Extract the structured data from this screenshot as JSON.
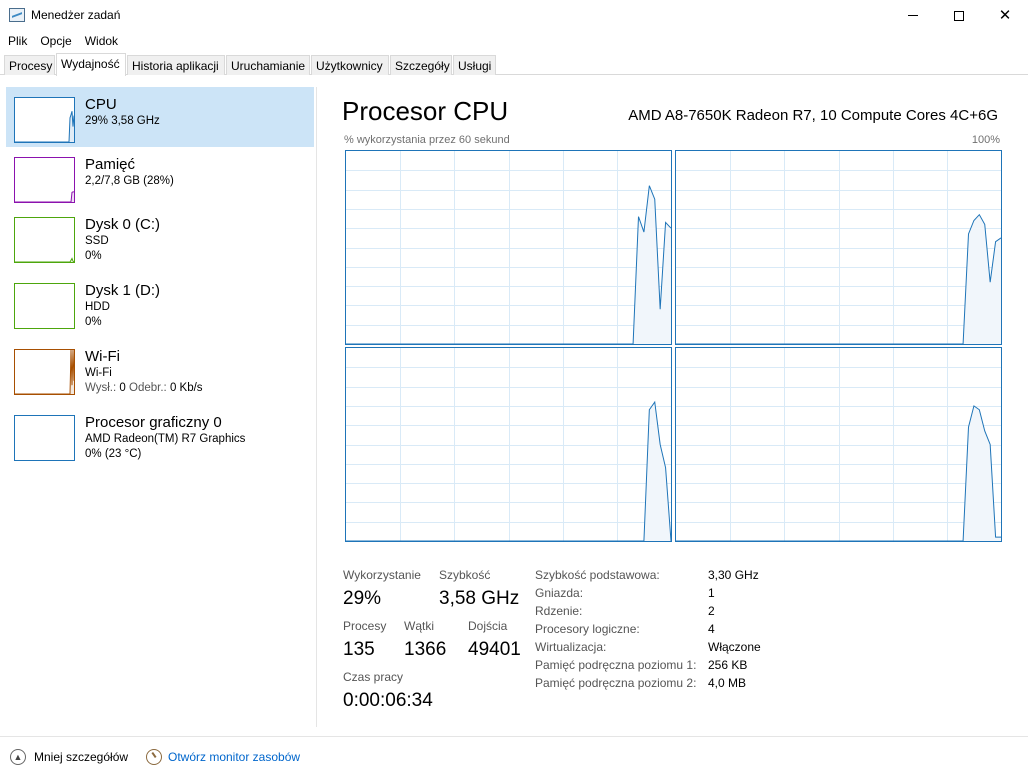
{
  "window": {
    "title": "Menedżer zadań",
    "icon": "task-manager-icon",
    "controls": {
      "minimize": "minimize-icon",
      "maximize": "maximize-icon",
      "close": "✕"
    }
  },
  "menu": [
    "Plik",
    "Opcje",
    "Widok"
  ],
  "tabs": [
    "Procesy",
    "Wydajność",
    "Historia aplikacji",
    "Uruchamianie",
    "Użytkownicy",
    "Szczegóły",
    "Usługi"
  ],
  "active_tab": "Wydajność",
  "sidebar": {
    "items": [
      {
        "title": "CPU",
        "line1": "29% 3,58 GHz",
        "line2": "",
        "color": "#1e74b8",
        "active": true,
        "thumb_series": [
          0,
          0,
          0,
          0,
          0,
          0,
          0,
          0,
          0,
          0,
          0,
          0,
          0,
          0,
          0,
          0,
          0,
          0,
          0,
          0,
          0,
          0,
          0,
          0,
          0,
          0,
          0,
          0,
          0,
          0,
          0,
          0,
          0,
          0,
          0,
          0,
          0,
          0,
          0,
          0,
          0,
          0,
          0,
          0,
          0,
          0,
          0,
          0,
          0,
          0,
          0,
          0,
          0,
          0,
          0,
          55,
          62,
          70,
          35,
          60
        ]
      },
      {
        "title": "Pamięć",
        "line1": "2,2/7,8 GB (28%)",
        "line2": "",
        "color": "#8b12ae",
        "active": false,
        "thumb_series": [
          0,
          0,
          0,
          0,
          0,
          0,
          0,
          0,
          0,
          0,
          0,
          0,
          0,
          0,
          0,
          0,
          0,
          0,
          0,
          0,
          0,
          0,
          0,
          0,
          0,
          0,
          0,
          0,
          0,
          0,
          0,
          0,
          0,
          0,
          0,
          0,
          0,
          0,
          0,
          0,
          0,
          0,
          0,
          0,
          0,
          0,
          0,
          0,
          0,
          0,
          0,
          0,
          0,
          0,
          0,
          0,
          0,
          22,
          23,
          23
        ]
      },
      {
        "title": "Dysk 0 (C:)",
        "line1": "SSD",
        "line2": "0%",
        "color": "#4da60c",
        "active": false,
        "thumb_series": [
          0,
          0,
          0,
          0,
          0,
          0,
          0,
          0,
          0,
          0,
          0,
          0,
          0,
          0,
          0,
          0,
          0,
          0,
          0,
          0,
          0,
          0,
          0,
          0,
          0,
          0,
          0,
          0,
          0,
          0,
          0,
          0,
          0,
          0,
          0,
          0,
          0,
          0,
          0,
          0,
          0,
          0,
          0,
          0,
          0,
          0,
          0,
          0,
          0,
          0,
          0,
          0,
          0,
          0,
          0,
          0,
          4,
          8,
          2,
          0
        ]
      },
      {
        "title": "Dysk 1 (D:)",
        "line1": "HDD",
        "line2": "0%",
        "color": "#4da60c",
        "active": false,
        "thumb_series": [
          0,
          0,
          0,
          0,
          0,
          0,
          0,
          0,
          0,
          0,
          0,
          0,
          0,
          0,
          0,
          0,
          0,
          0,
          0,
          0,
          0,
          0,
          0,
          0,
          0,
          0,
          0,
          0,
          0,
          0,
          0,
          0,
          0,
          0,
          0,
          0,
          0,
          0,
          0,
          0,
          0,
          0,
          0,
          0,
          0,
          0,
          0,
          0,
          0,
          0,
          0,
          0,
          0,
          0,
          0,
          0,
          0,
          0,
          0,
          0
        ]
      },
      {
        "title": "Wi-Fi",
        "line1": "Wi-Fi",
        "line2_label_send": "Wysł.:",
        "line2_send": "0",
        "line2_label_recv": "Odebr.:",
        "line2_recv": "0 Kb/s",
        "color": "#a74f01",
        "active": false,
        "thumb_series": [
          0,
          0,
          0,
          0,
          0,
          0,
          0,
          0,
          0,
          0,
          0,
          0,
          0,
          0,
          0,
          0,
          0,
          0,
          0,
          0,
          0,
          0,
          0,
          0,
          0,
          0,
          0,
          0,
          0,
          0,
          0,
          0,
          0,
          0,
          0,
          0,
          0,
          0,
          0,
          0,
          0,
          0,
          0,
          0,
          0,
          0,
          0,
          0,
          0,
          0,
          0,
          0,
          0,
          0,
          0,
          0,
          100,
          20,
          100,
          30
        ]
      },
      {
        "title": "Procesor graficzny 0",
        "line1": "AMD Radeon(TM) R7 Graphics",
        "line2": "0% (23 °C)",
        "color": "#1e74b8",
        "active": false,
        "thumb_series": [
          0,
          0,
          0,
          0,
          0,
          0,
          0,
          0,
          0,
          0,
          0,
          0,
          0,
          0,
          0,
          0,
          0,
          0,
          0,
          0,
          0,
          0,
          0,
          0,
          0,
          0,
          0,
          0,
          0,
          0,
          0,
          0,
          0,
          0,
          0,
          0,
          0,
          0,
          0,
          0,
          0,
          0,
          0,
          0,
          0,
          0,
          0,
          0,
          0,
          0,
          0,
          0,
          0,
          0,
          0,
          0,
          0,
          0,
          0,
          0
        ]
      }
    ]
  },
  "main": {
    "title": "Procesor CPU",
    "cpu_model": "AMD A8-7650K Radeon R7, 10 Compute Cores 4C+6G",
    "graph_caption": "% wykorzystania przez 60 sekund",
    "graph_max": "100%",
    "graph_color": "#1e74b8",
    "graph_fill": "#f1f6fb",
    "grid_color": "#d9eaf7"
  },
  "chart_data": {
    "type": "area",
    "x_range": [
      0,
      60
    ],
    "ylim": [
      0,
      100
    ],
    "grid": true,
    "series": [
      {
        "values": [
          0,
          0,
          0,
          0,
          0,
          0,
          0,
          0,
          0,
          0,
          0,
          0,
          0,
          0,
          0,
          0,
          0,
          0,
          0,
          0,
          0,
          0,
          0,
          0,
          0,
          0,
          0,
          0,
          0,
          0,
          0,
          0,
          0,
          0,
          0,
          0,
          0,
          0,
          0,
          0,
          0,
          0,
          0,
          0,
          0,
          0,
          0,
          0,
          0,
          0,
          0,
          0,
          0,
          0,
          0,
          0,
          66,
          58,
          82,
          75,
          18,
          63,
          60
        ]
      },
      {
        "values": [
          0,
          0,
          0,
          0,
          0,
          0,
          0,
          0,
          0,
          0,
          0,
          0,
          0,
          0,
          0,
          0,
          0,
          0,
          0,
          0,
          0,
          0,
          0,
          0,
          0,
          0,
          0,
          0,
          0,
          0,
          0,
          0,
          0,
          0,
          0,
          0,
          0,
          0,
          0,
          0,
          0,
          0,
          0,
          0,
          0,
          0,
          0,
          0,
          0,
          0,
          0,
          0,
          0,
          0,
          0,
          0,
          0,
          57,
          64,
          67,
          62,
          32,
          53,
          55
        ]
      },
      {
        "values": [
          0,
          0,
          0,
          0,
          0,
          0,
          0,
          0,
          0,
          0,
          0,
          0,
          0,
          0,
          0,
          0,
          0,
          0,
          0,
          0,
          0,
          0,
          0,
          0,
          0,
          0,
          0,
          0,
          0,
          0,
          0,
          0,
          0,
          0,
          0,
          0,
          0,
          0,
          0,
          0,
          0,
          0,
          0,
          0,
          0,
          0,
          0,
          0,
          0,
          0,
          0,
          0,
          0,
          0,
          0,
          0,
          0,
          68,
          72,
          50,
          38,
          0
        ]
      },
      {
        "values": [
          0,
          0,
          0,
          0,
          0,
          0,
          0,
          0,
          0,
          0,
          0,
          0,
          0,
          0,
          0,
          0,
          0,
          0,
          0,
          0,
          0,
          0,
          0,
          0,
          0,
          0,
          0,
          0,
          0,
          0,
          0,
          0,
          0,
          0,
          0,
          0,
          0,
          0,
          0,
          0,
          0,
          0,
          0,
          0,
          0,
          0,
          0,
          0,
          0,
          0,
          0,
          0,
          0,
          0,
          0,
          0,
          0,
          59,
          70,
          68,
          57,
          50,
          2,
          2
        ]
      }
    ]
  },
  "stats": {
    "usage_label": "Wykorzystanie",
    "usage_value": "29%",
    "speed_label": "Szybkość",
    "speed_value": "3,58 GHz",
    "processes_label": "Procesy",
    "processes_value": "135",
    "threads_label": "Wątki",
    "threads_value": "1366",
    "handles_label": "Dojścia",
    "handles_value": "49401",
    "uptime_label": "Czas pracy",
    "uptime_value": "0:00:06:34"
  },
  "details": [
    {
      "label": "Szybkość podstawowa:",
      "value": "3,30 GHz"
    },
    {
      "label": "Gniazda:",
      "value": "1"
    },
    {
      "label": "Rdzenie:",
      "value": "2"
    },
    {
      "label": "Procesory logiczne:",
      "value": "4"
    },
    {
      "label": "Wirtualizacja:",
      "value": "Włączone"
    },
    {
      "label": "Pamięć podręczna poziomu 1:",
      "value": "256 KB"
    },
    {
      "label": "Pamięć podręczna poziomu 2:",
      "value": "4,0 MB"
    }
  ],
  "footer": {
    "less_details": "Mniej szczegółów",
    "resource_monitor": "Otwórz monitor zasobów"
  }
}
